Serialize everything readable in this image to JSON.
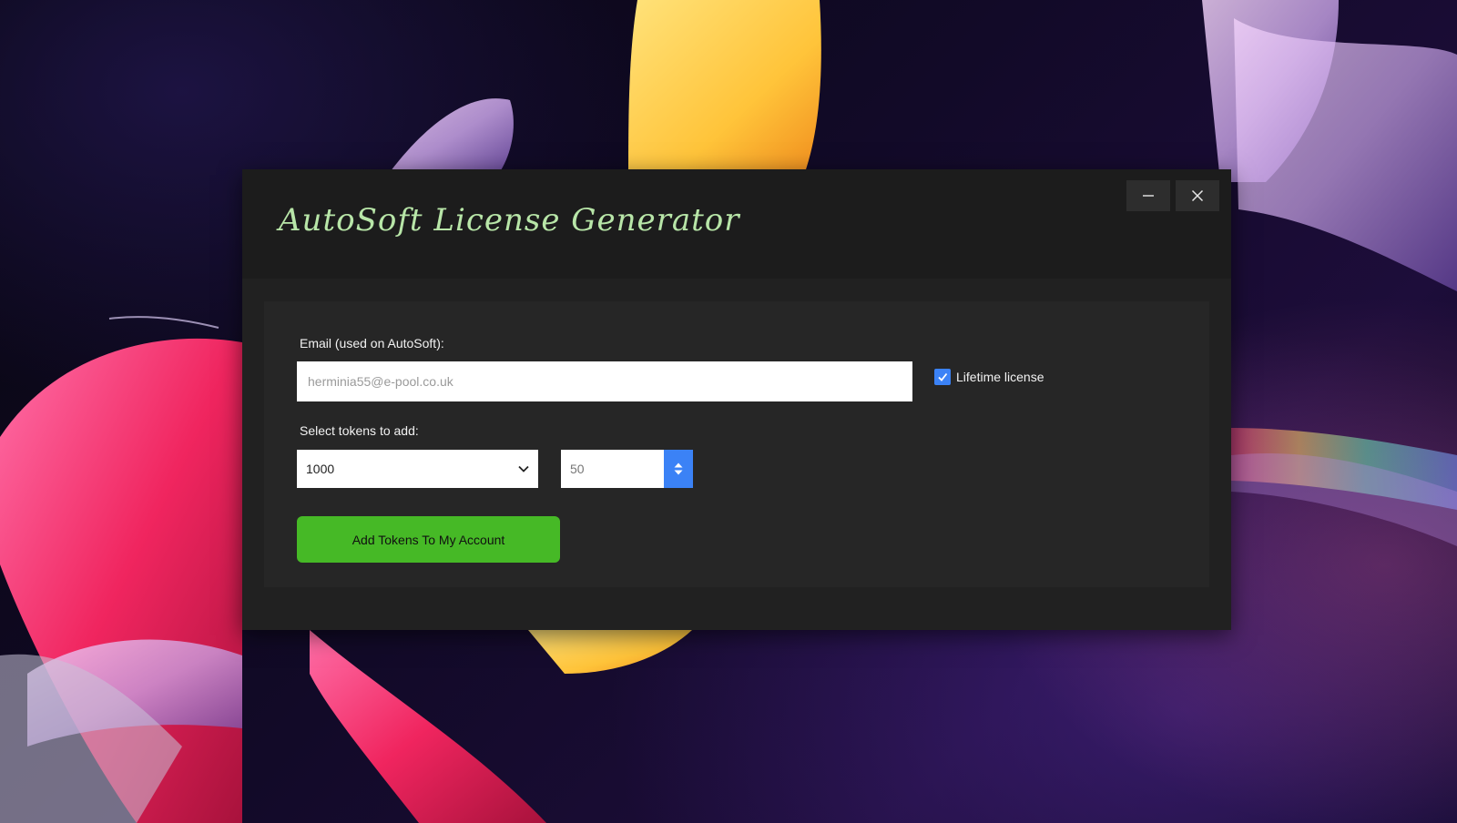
{
  "window": {
    "title": "AutoSoft License Generator",
    "minimize_icon": "minimize-icon",
    "close_icon": "close-icon"
  },
  "form": {
    "email_label": "Email (used on AutoSoft):",
    "email_placeholder": "herminia55@e-pool.co.uk",
    "email_value": "",
    "lifetime_label": "Lifetime license",
    "lifetime_checked": true,
    "tokens_label": "Select tokens to add:",
    "tokens_selected": "1000",
    "quantity_value": "50",
    "submit_label": "Add Tokens To My Account"
  },
  "colors": {
    "title": "#b8e6a8",
    "accent_blue": "#3b82f6",
    "button_green": "#46b926",
    "window_bg": "#212121",
    "panel_bg": "#262626"
  }
}
